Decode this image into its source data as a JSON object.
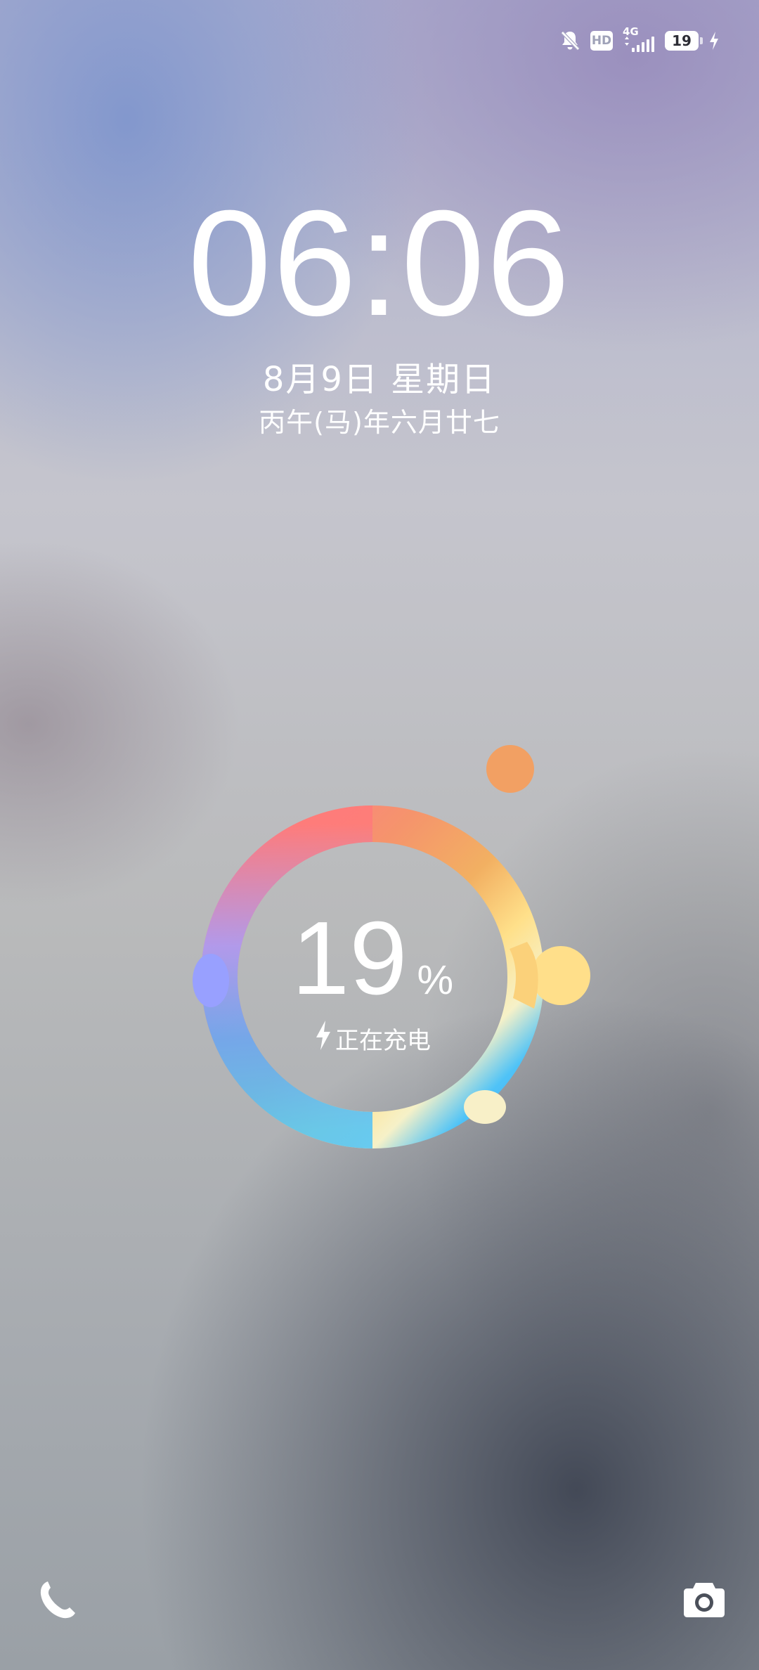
{
  "status_bar": {
    "icons": [
      "bell-off-icon",
      "hd-icon",
      "signal-4g-icon",
      "battery-icon",
      "charging-bolt-icon"
    ],
    "hd_label": "HD",
    "network_label": "4G",
    "battery_level": "19"
  },
  "lock_screen": {
    "time": "06:06",
    "date": "8月9日 星期日",
    "lunar_date": "丙午(马)年六月廿七"
  },
  "charging": {
    "percent": "19",
    "percent_sign": "%",
    "status": "正在充电",
    "level_fraction": 0.19,
    "colors": [
      "#ff7a7a",
      "#f2ae5e",
      "#ffe08a",
      "#4fc3f7",
      "#8fa0ff",
      "#f2a063"
    ]
  },
  "shortcuts": {
    "left_icon": "phone-icon",
    "right_icon": "camera-icon"
  }
}
